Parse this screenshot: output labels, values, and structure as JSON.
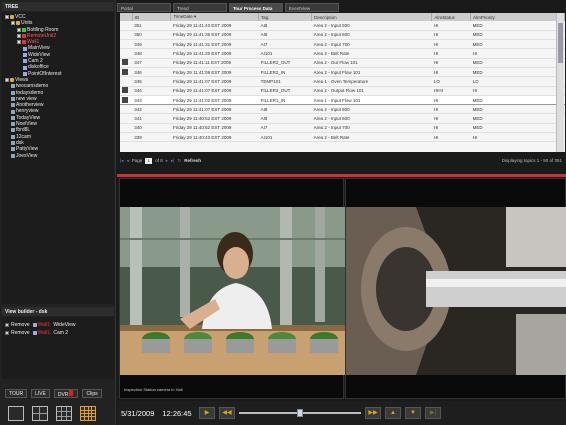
{
  "tree": {
    "header": "TREE",
    "items": [
      {
        "label": "VCC",
        "indent": 0,
        "icon": "folder-icon",
        "expander": true
      },
      {
        "label": "Units",
        "indent": 1,
        "icon": "folder-icon",
        "expander": true
      },
      {
        "label": "Bottling Room",
        "indent": 2,
        "icon": "unit-icon",
        "status": "green",
        "expander": true
      },
      {
        "label": "RemoteUnit2",
        "indent": 2,
        "icon": "unit-icon",
        "status": "red",
        "expander": true
      },
      {
        "label": "Wall1",
        "indent": 2,
        "icon": "unit-icon",
        "status": "red",
        "expander": true
      },
      {
        "label": "MainView",
        "indent": 3,
        "icon": "camera-icon"
      },
      {
        "label": "WideView",
        "indent": 3,
        "icon": "camera-icon"
      },
      {
        "label": "Cam 2",
        "indent": 3,
        "icon": "camera-icon"
      },
      {
        "label": "diskoffice",
        "indent": 3,
        "icon": "camera-icon"
      },
      {
        "label": "PointOfInterest",
        "indent": 3,
        "icon": "camera-icon"
      },
      {
        "label": "Views",
        "indent": 0,
        "icon": "folder-icon",
        "expander": true
      },
      {
        "label": "twocamsdemo",
        "indent": 1,
        "icon": "view-icon"
      },
      {
        "label": "todaysdemo",
        "indent": 1,
        "icon": "view-icon"
      },
      {
        "label": "new view",
        "indent": 1,
        "icon": "view-icon"
      },
      {
        "label": "Anotherview",
        "indent": 1,
        "icon": "view-icon"
      },
      {
        "label": "henryview",
        "indent": 1,
        "icon": "view-icon"
      },
      {
        "label": "TodayView",
        "indent": 1,
        "icon": "view-icon"
      },
      {
        "label": "NoelView",
        "indent": 1,
        "icon": "view-icon"
      },
      {
        "label": "fbrd8L",
        "indent": 1,
        "icon": "view-icon"
      },
      {
        "label": "12cam",
        "indent": 1,
        "icon": "view-icon"
      },
      {
        "label": "dsk",
        "indent": 1,
        "icon": "view-icon"
      },
      {
        "label": "PattyView",
        "indent": 1,
        "icon": "view-icon"
      },
      {
        "label": "JoesView",
        "indent": 1,
        "icon": "view-icon"
      }
    ]
  },
  "view_builder": {
    "header": "View builder - dsk",
    "rows": [
      {
        "action": "Remove",
        "unit": "Wall1:",
        "camera": "WideView"
      },
      {
        "action": "Remove",
        "unit": "Wall1:",
        "camera": "Cam 2"
      }
    ]
  },
  "mode_bar": {
    "tour": "TOUR",
    "live": "LIVE",
    "dvr": "DVR",
    "clips": "Clips"
  },
  "tabs": [
    {
      "label": "Portal",
      "active": false
    },
    {
      "label": "Trend",
      "active": false
    },
    {
      "label": "Tour Process Data",
      "active": true
    },
    {
      "label": "EventView",
      "active": false
    }
  ],
  "table": {
    "columns": [
      "",
      "ID",
      "TimeDate ▾",
      "Tag",
      "Description",
      "AlmStatus",
      "AlmPriority"
    ],
    "rows": [
      {
        "icon": false,
        "id": "351",
        "time": "Friday 29 11:41:43 EST 2009",
        "tag": "AI8",
        "desc": "Area 2 - Input 500",
        "status": "HI",
        "priority": "MED",
        "selected": false
      },
      {
        "icon": false,
        "id": "350",
        "time": "Friday 29 11:41:36 EST 2009",
        "tag": "AI8",
        "desc": "Area 2 - Input 600",
        "status": "HI",
        "priority": "MED",
        "selected": false
      },
      {
        "icon": false,
        "id": "349",
        "time": "Friday 29 11:41:31 EST 2009",
        "tag": "AI7",
        "desc": "Area 2 - Input 700",
        "status": "HI",
        "priority": "MED",
        "selected": false
      },
      {
        "icon": false,
        "id": "348",
        "time": "Friday 29 11:41:20 EST 2009",
        "tag": "AI101",
        "desc": "Area 2 - Belt Rate",
        "status": "HI",
        "priority": "HI",
        "selected": false
      },
      {
        "icon": true,
        "id": "347",
        "time": "Friday 29 11:41:11 EST 2009",
        "tag": "FILLER2_OUT",
        "desc": "Area 2 - Out Flow 101",
        "status": "HI",
        "priority": "MED",
        "selected": false
      },
      {
        "icon": true,
        "id": "346",
        "time": "Friday 29 11:41:09 EST 2009",
        "tag": "FILLER2_IN",
        "desc": "Area 2 - Input Flow 101",
        "status": "HI",
        "priority": "MED",
        "selected": false
      },
      {
        "icon": false,
        "id": "345",
        "time": "Friday 29 11:41:07 EST 2009",
        "tag": "TEMP101",
        "desc": "Area 1 - Oven Temperature",
        "status": "LO",
        "priority": "LO",
        "selected": false
      },
      {
        "icon": true,
        "id": "344",
        "time": "Friday 29 11:41:07 EST 2009",
        "tag": "FILLER2_OUT",
        "desc": "Area 2 - Output Flow 101",
        "status": "HIHI",
        "priority": "HI",
        "selected": false
      },
      {
        "icon": true,
        "id": "343",
        "time": "Friday 29 11:41:02 EST 2009",
        "tag": "FILLER1_IN",
        "desc": "Area 1 - Input Flow 101",
        "status": "HI",
        "priority": "MED",
        "selected": true
      },
      {
        "icon": false,
        "id": "342",
        "time": "Friday 29 11:41:07 EST 2009",
        "tag": "AI8",
        "desc": "Area 2 - Input 500",
        "status": "HI",
        "priority": "MED",
        "selected": false
      },
      {
        "icon": false,
        "id": "341",
        "time": "Friday 29 11:40:52 EST 2009",
        "tag": "AI8",
        "desc": "Area 2 - Input 600",
        "status": "HI",
        "priority": "MED",
        "selected": false
      },
      {
        "icon": false,
        "id": "340",
        "time": "Friday 29 11:40:52 EST 2009",
        "tag": "AI7",
        "desc": "Area 2 - Input 700",
        "status": "HI",
        "priority": "MED",
        "selected": false
      },
      {
        "icon": false,
        "id": "339",
        "time": "Friday 29 11:40:43 EST 2009",
        "tag": "AI101",
        "desc": "Area 2 - Belt Rate",
        "status": "HI",
        "priority": "HI",
        "selected": false
      }
    ]
  },
  "pager": {
    "page_label": "Page",
    "page_value": "1",
    "of_label": "of 8",
    "refresh": "Refresh",
    "summary": "Displaying topics 1 - 50 of 351"
  },
  "video": {
    "cam1_label": "Inspection Station camera in Hall"
  },
  "controls": {
    "date": "5/31/2009",
    "time": "12:26:45",
    "slider_position": 0.5
  }
}
